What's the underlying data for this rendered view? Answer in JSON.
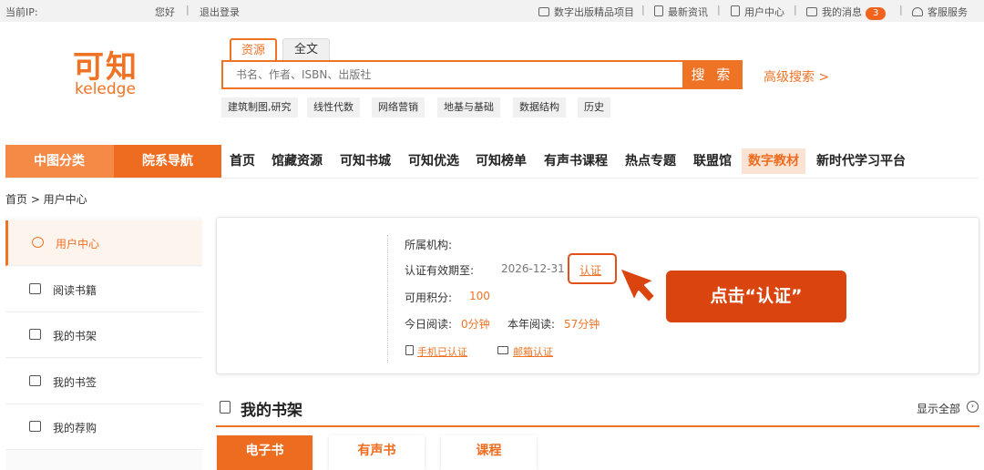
{
  "topbar": {
    "ip_label": "当前IP:",
    "greeting": "您好",
    "logout": "退出登录",
    "links": [
      "数字出版精品项目",
      "最新资讯",
      "用户中心",
      "我的消息",
      "客服服务"
    ],
    "message_count": "3",
    "separator": "|"
  },
  "logo": {
    "cn": "可知",
    "en": "keledge"
  },
  "search": {
    "tabs": [
      "资源",
      "全文"
    ],
    "placeholder": "书名、作者、ISBN、出版社",
    "button": "搜 索",
    "advanced": "高级搜索 >",
    "hot_tags": [
      "建筑制图,研究",
      "线性代数",
      "网络营销",
      "地基与基础",
      "数据结构",
      "历史"
    ]
  },
  "nav": {
    "category": "中图分类",
    "department": "院系导航",
    "items": [
      "首页",
      "馆藏资源",
      "可知书城",
      "可知优选",
      "可知榜单",
      "有声书课程",
      "热点专题",
      "联盟馆",
      "数字教材",
      "新时代学习平台"
    ]
  },
  "breadcrumb": "首页 > 用户中心",
  "sidebar": {
    "items": [
      "用户中心",
      "阅读书籍",
      "我的书架",
      "我的书签",
      "我的荐购"
    ]
  },
  "profile": {
    "institution_label": "所属机构:",
    "expiry_label": "认证有效期至:",
    "expiry_value": "2026-12-31",
    "verify_link": "认证",
    "points_label": "可用积分:",
    "points_value": "100",
    "today_label": "今日阅读:",
    "today_value": "0分钟",
    "year_label": "本年阅读:",
    "year_value": "57分钟",
    "phone_verified": "手机已认证",
    "email_verify": "邮箱认证"
  },
  "callout": "点击“认证”",
  "shelf": {
    "title": "我的书架",
    "show_all": "显示全部",
    "tabs": [
      "电子书",
      "有声书",
      "课程"
    ]
  },
  "colors": {
    "accent": "#ef7325",
    "callout": "#d9440f"
  }
}
